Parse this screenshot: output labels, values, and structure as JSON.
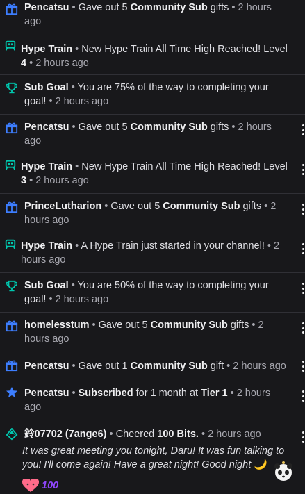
{
  "colors": {
    "background": "#18181b",
    "divider": "#303036",
    "gift_icon": "#3d7eff",
    "hype_train_icon": "#00c8af",
    "goal_icon": "#00c8af",
    "subscribe_icon": "#3d7eff",
    "bits_icon": "#00c8af",
    "bits_amount": "#9147ff"
  },
  "separator": "•",
  "items": [
    {
      "icon": "gift-icon",
      "name": "Pencatsu",
      "pre": "Gave out 5 ",
      "bold": "Community Sub",
      "post": " gifts",
      "time_a": "2 hours",
      "time_b": "ago"
    },
    {
      "icon": "hype-train-icon",
      "name": "Hype Train",
      "line1": "New Hype Train All Time High Reached! Level",
      "level": "4",
      "time": "2 hours ago"
    },
    {
      "icon": "trophy-icon",
      "name": "Sub Goal",
      "line1": "You are 75% of the way to completing your",
      "line2": "goal!",
      "time": "2 hours ago"
    },
    {
      "icon": "gift-icon",
      "name": "Pencatsu",
      "pre": "Gave out 5 ",
      "bold": "Community Sub",
      "post": " gifts",
      "time_a": "2 hours",
      "time_b": "ago"
    },
    {
      "icon": "hype-train-icon",
      "name": "Hype Train",
      "line1": "New Hype Train All Time High Reached! Level",
      "level": "3",
      "time": "2 hours ago"
    },
    {
      "icon": "gift-icon",
      "name": "PrinceLutharion",
      "pre": "Gave out 5 ",
      "bold": "Community Sub",
      "post": " gifts",
      "time_a": "2",
      "time_b": "hours ago"
    },
    {
      "icon": "hype-train-icon",
      "name": "Hype Train",
      "line1": "A Hype Train just started in your channel!",
      "time_a": "2",
      "time_b": "hours ago"
    },
    {
      "icon": "trophy-icon",
      "name": "Sub Goal",
      "line1": "You are 50% of the way to completing your",
      "line2": "goal!",
      "time": "2 hours ago"
    },
    {
      "icon": "gift-icon",
      "name": "homelesstum",
      "pre": "Gave out 5 ",
      "bold": "Community Sub",
      "post": " gifts",
      "time_a": "2",
      "time_b": "hours ago"
    },
    {
      "icon": "gift-icon",
      "name": "Pencatsu",
      "pre": "Gave out 1 ",
      "bold": "Community Sub",
      "post": " gift",
      "time": "2 hours ago"
    },
    {
      "icon": "star-icon",
      "name": "Pencatsu",
      "bold": "Subscribed",
      "mid": " for 1 month at ",
      "tier": "Tier 1",
      "time_a": "2 hours",
      "time_b": "ago"
    },
    {
      "icon": "bits-icon",
      "name": "鈴07702 (7ange6)",
      "pre": "Cheered ",
      "bold": "100 Bits.",
      "time": "2 hours ago",
      "message": "It was great meeting you tonight, Daru! It was fun talking to you! I'll come again! Have a great night! Good night 🌙",
      "bits_amount": "100"
    }
  ]
}
